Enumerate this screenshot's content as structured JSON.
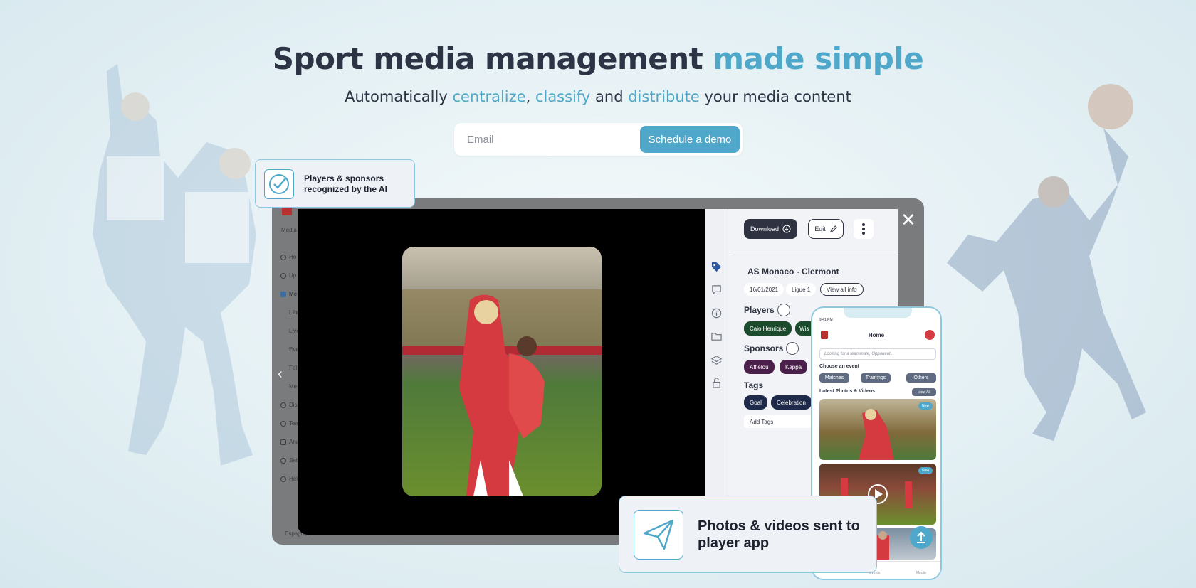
{
  "hero": {
    "title_start": "Sport media management ",
    "title_accent": "made simple",
    "subtitle": {
      "p1": "Automatically ",
      "w1": "centralize",
      "p2": ", ",
      "w2": "classify",
      "p3": " and ",
      "w3": "distribute",
      "p4": " your media content"
    }
  },
  "signup": {
    "email_placeholder": "Email",
    "cta_label": "Schedule a demo"
  },
  "callouts": {
    "ai": "Players & sponsors recognized by the AI",
    "sent": "Photos & videos sent to player app"
  },
  "dashboard": {
    "sidebar": {
      "brand": "Media",
      "items": [
        "Ho",
        "Up",
        "Me",
        "Libr",
        "Live",
        "Eve",
        "Fol",
        "Me",
        "Dis",
        "Tea",
        "Ana",
        "Set",
        "Hel"
      ],
      "language": "Espagnol"
    },
    "viewer": {
      "close": "✕",
      "prev": "‹"
    },
    "panel": {
      "download_label": "Download",
      "edit_label": "Edit",
      "match_title": "AS Monaco - Clermont",
      "date": "16/01/2021",
      "league": "Ligue 1",
      "view_all_info": "View all info",
      "players_title": "Players",
      "players": [
        "Caio Henrique",
        "Wis"
      ],
      "sponsors_title": "Sponsors",
      "sponsors": [
        "Afflelou",
        "Kappa"
      ],
      "tags_title": "Tags",
      "tags": [
        "Goal",
        "Celebration"
      ],
      "add_tags": "Add Tags"
    }
  },
  "phone": {
    "time": "9:41 PM",
    "header": "Home",
    "search_placeholder": "Looking for a teammate, Opponent...",
    "choose_event": "Choose an event",
    "event_chips": [
      "Matches",
      "Trainings",
      "Others"
    ],
    "latest_title": "Latest Photos & Videos",
    "view_all": "View All",
    "new_badge": "New",
    "bottom_nav": [
      "Events",
      "Media"
    ]
  },
  "colors": {
    "accent": "#4fa8c9",
    "dark": "#2c3445",
    "player_chip": "#1c4a2c",
    "sponsor_chip": "#4a1f4a",
    "tag_chip": "#1f2a4a"
  }
}
